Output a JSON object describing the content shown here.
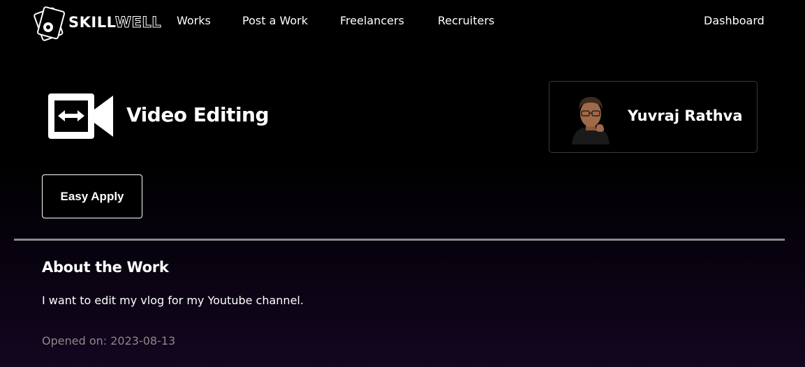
{
  "nav": {
    "logo": {
      "part1": "SKILL",
      "part2": "WELL"
    },
    "links": [
      "Works",
      "Post a Work",
      "Freelancers",
      "Recruiters"
    ],
    "dashboard": "Dashboard"
  },
  "job": {
    "title": "Video Editing",
    "icon": "video-editing-icon",
    "apply_label": "Easy Apply"
  },
  "poster": {
    "name": "Yuvraj Rathva"
  },
  "about": {
    "heading": "About the Work",
    "description": "I want to edit my vlog for my Youtube channel.",
    "opened": "Opened on: 2023-08-13"
  },
  "colors": {
    "background": "#000000",
    "text": "#ffffff",
    "muted": "#8a8a8a",
    "divider": "#8a8a8a"
  }
}
